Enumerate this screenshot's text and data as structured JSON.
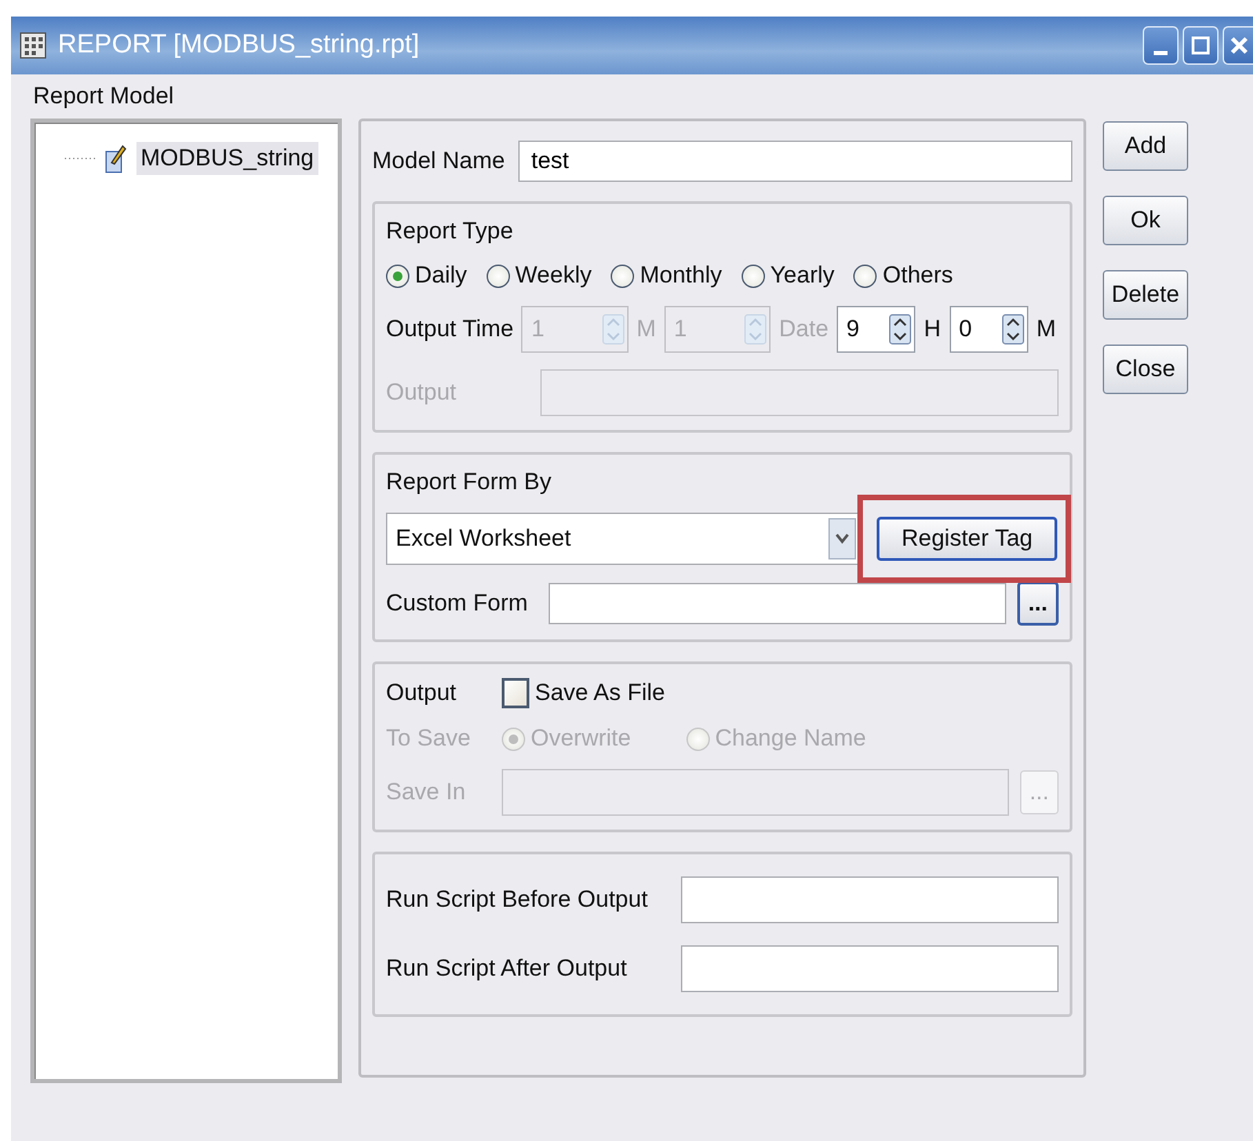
{
  "window": {
    "title": "REPORT [MODBUS_string.rpt]"
  },
  "report_model": {
    "label": "Report Model",
    "tree": [
      {
        "label": "MODBUS_string",
        "selected": true
      }
    ]
  },
  "model_name": {
    "label": "Model Name",
    "value": "test"
  },
  "report_type": {
    "label": "Report Type",
    "options": [
      {
        "label": "Daily",
        "selected": true
      },
      {
        "label": "Weekly",
        "selected": false
      },
      {
        "label": "Monthly",
        "selected": false
      },
      {
        "label": "Yearly",
        "selected": false
      },
      {
        "label": "Others",
        "selected": false
      }
    ],
    "output_time": {
      "label": "Output Time",
      "spinners": [
        {
          "value": "1",
          "unit": "M",
          "disabled": true
        },
        {
          "value": "1",
          "unit": "Date",
          "disabled": true
        },
        {
          "value": "9",
          "unit": "H",
          "disabled": false
        },
        {
          "value": "0",
          "unit": "M",
          "disabled": false
        }
      ]
    },
    "output": {
      "label": "Output",
      "disabled": true
    }
  },
  "report_form": {
    "label": "Report Form By",
    "select_value": "Excel Worksheet",
    "register_button": "Register Tag",
    "highlighted": true,
    "custom_form_label": "Custom Form",
    "browse_button": "..."
  },
  "output": {
    "label": "Output",
    "save_as_file": {
      "label": "Save As File",
      "checked": false
    },
    "to_save": {
      "label": "To Save",
      "disabled": true,
      "options": [
        {
          "label": "Overwrite",
          "selected": true
        },
        {
          "label": "Change Name",
          "selected": false
        }
      ]
    },
    "save_in": {
      "label": "Save In",
      "disabled": true,
      "browse_button": "..."
    }
  },
  "scripts": [
    {
      "label": "Run Script Before Output"
    },
    {
      "label": "Run Script After Output"
    }
  ],
  "buttons": [
    {
      "label": "Add"
    },
    {
      "label": "Ok"
    },
    {
      "label": "Delete"
    },
    {
      "label": "Close"
    }
  ]
}
